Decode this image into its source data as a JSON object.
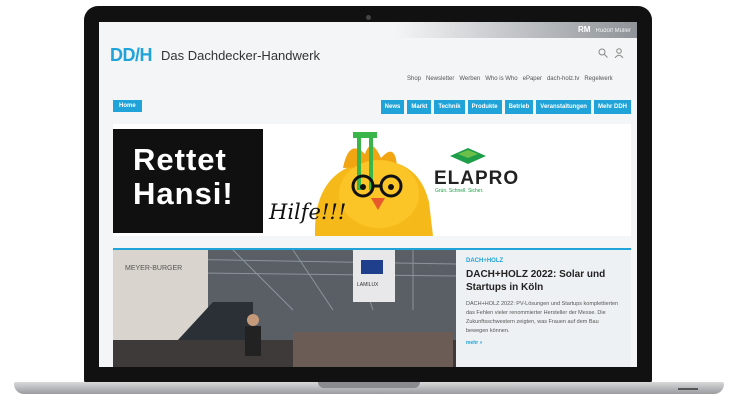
{
  "header": {
    "user_initials": "RM",
    "user_name": "Rudolf Müller",
    "logo": "DD/H",
    "site_title": "Das Dachdecker-Handwerk",
    "search_icon": "search-icon",
    "account_icon": "user-icon"
  },
  "topnav": [
    "Shop",
    "Newsletter",
    "Werben",
    "Who is Who",
    "ePaper",
    "dach-holz.tv",
    "Regelwerk"
  ],
  "mainnav": {
    "home": "Home",
    "tabs": [
      "News",
      "Markt",
      "Technik",
      "Produkte",
      "Betrieb",
      "Veranstaltungen",
      "Mehr DDH"
    ]
  },
  "banner": {
    "headline_line1": "Rettet",
    "headline_line2": "Hansi!",
    "hilfe": "Hilfe!!!",
    "brand": "ELAPRO",
    "tagline": "Grün. Schnell. Sicher."
  },
  "article": {
    "kicker": "DACH+HOLZ",
    "title": "DACH+HOLZ 2022: Solar und Startups in Köln",
    "body": "DACH+HOLZ 2022: PV-Lösungen und Startups komplettierten das Fehlen vieler renommierter Hersteller der Messe. Die Zukunftsschwestern zeigten, was Frauen auf dem Bau bewegen können.",
    "more": "mehr »"
  },
  "photo_signs": {
    "left": "MEYER-BURGER",
    "right": "LAMILUX"
  },
  "colors": {
    "accent": "#1fa3d8",
    "brand_green": "#1e9e49"
  }
}
